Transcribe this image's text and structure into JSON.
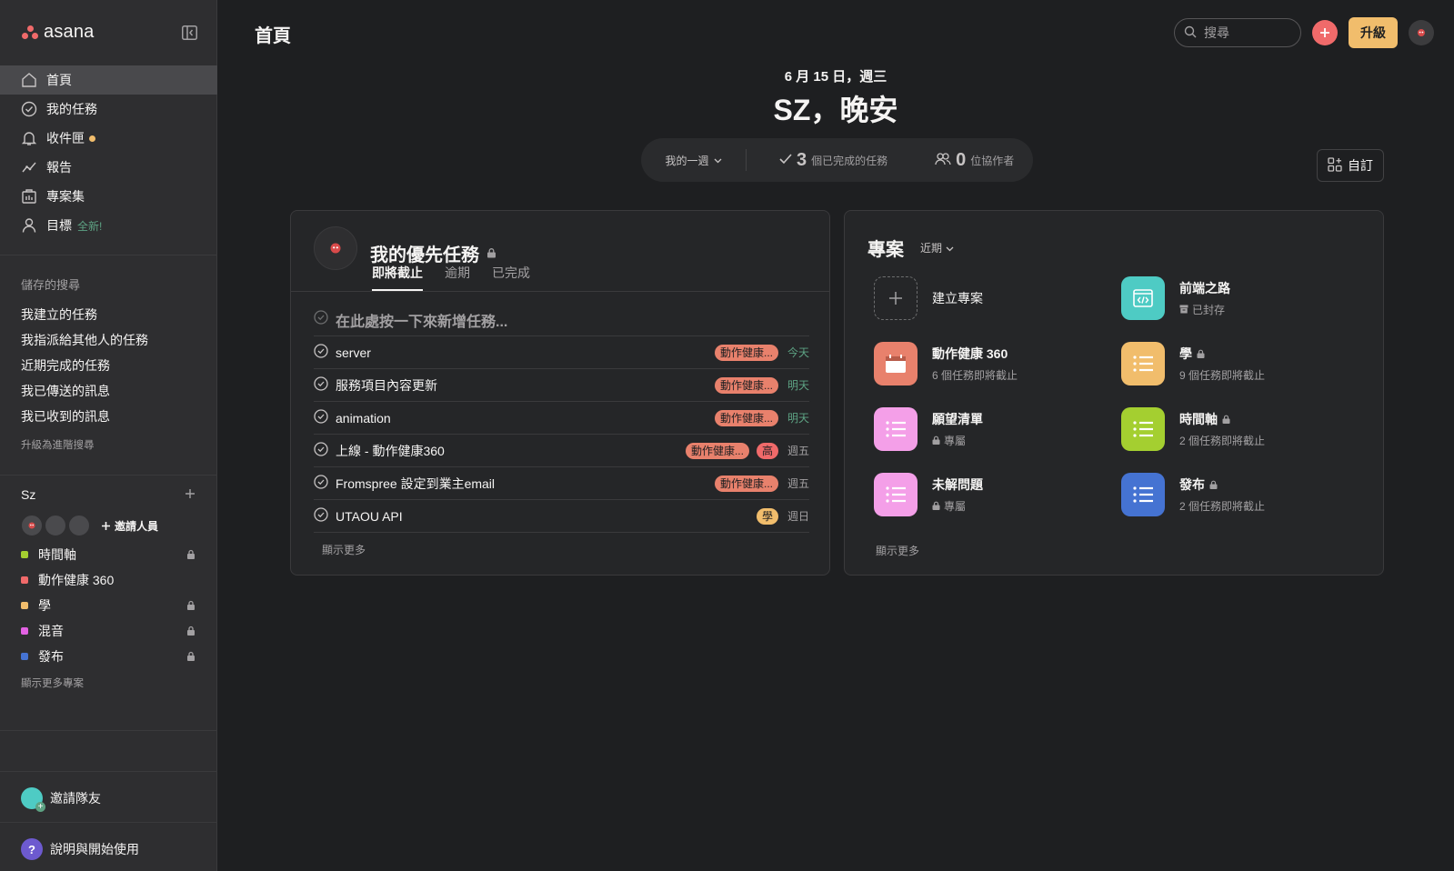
{
  "brand": {
    "name": "asana"
  },
  "colors": {
    "accent": "#f06a6a",
    "upgrade": "#f1bd6c",
    "green": "#5da283"
  },
  "nav": {
    "items": [
      {
        "label": "首頁",
        "icon": "home-icon"
      },
      {
        "label": "我的任務",
        "icon": "check-circle-icon"
      },
      {
        "label": "收件匣",
        "icon": "bell-icon"
      },
      {
        "label": "報告",
        "icon": "chart-line-icon"
      },
      {
        "label": "專案集",
        "icon": "portfolio-icon"
      },
      {
        "label": "目標",
        "icon": "goal-icon",
        "tag": "全新!"
      }
    ]
  },
  "saved_searches": {
    "title": "儲存的搜尋",
    "items": [
      "我建立的任務",
      "我指派給其他人的任務",
      "近期完成的任務",
      "我已傳送的訊息",
      "我已收到的訊息"
    ],
    "upgrade_link": "升級為進階搜尋"
  },
  "team": {
    "name": "Sz",
    "invite_label": "邀請人員",
    "projects": [
      {
        "name": "時間軸",
        "color": "#a4cf30",
        "locked": true
      },
      {
        "name": "動作健康 360",
        "color": "#f06a6a",
        "locked": false
      },
      {
        "name": "學",
        "color": "#f1bd6c",
        "locked": true
      },
      {
        "name": "混音",
        "color": "#e362e3",
        "locked": true
      },
      {
        "name": "發布",
        "color": "#4573d2",
        "locked": true
      }
    ],
    "show_more": "顯示更多專案"
  },
  "bottom": {
    "invite_teammates": "邀請隊友",
    "help": "說明與開始使用",
    "help_glyph": "?"
  },
  "header": {
    "title": "首頁",
    "search_placeholder": "搜尋",
    "upgrade_label": "升級"
  },
  "greeting": {
    "date": "6 月 15 日，週三",
    "text": "SZ，晚安"
  },
  "stats": {
    "period": "我的一週",
    "completed_count": "3",
    "completed_label": "個已完成的任務",
    "collaborators_count": "0",
    "collaborators_label": "位協作者"
  },
  "customize_label": "自訂",
  "priorities": {
    "title": "我的優先任務",
    "tabs": [
      "即將截止",
      "逾期",
      "已完成"
    ],
    "add_placeholder": "在此處按一下來新增任務...",
    "tasks": [
      {
        "name": "server",
        "tags": [
          {
            "text": "動作健康...",
            "kind": "project"
          }
        ],
        "due": "今天",
        "due_green": true
      },
      {
        "name": "服務項目內容更新",
        "tags": [
          {
            "text": "動作健康...",
            "kind": "project"
          }
        ],
        "due": "明天",
        "due_green": true
      },
      {
        "name": "animation",
        "tags": [
          {
            "text": "動作健康...",
            "kind": "project"
          }
        ],
        "due": "明天",
        "due_green": true
      },
      {
        "name": "上線 - 動作健康360",
        "tags": [
          {
            "text": "動作健康...",
            "kind": "project"
          },
          {
            "text": "高",
            "kind": "high"
          }
        ],
        "due": "週五",
        "due_green": false
      },
      {
        "name": "Fromspree 設定到業主email",
        "tags": [
          {
            "text": "動作健康...",
            "kind": "project"
          }
        ],
        "due": "週五",
        "due_green": false
      },
      {
        "name": "UTAOU API",
        "tags": [
          {
            "text": "學",
            "kind": "study"
          }
        ],
        "due": "週日",
        "due_green": false
      }
    ],
    "show_more": "顯示更多"
  },
  "projects": {
    "title": "專案",
    "sort": "近期",
    "create_label": "建立專案",
    "items": [
      {
        "name": "前端之路",
        "sub": "已封存",
        "sub_icon": "archive-icon",
        "color": "#4ecbc4",
        "icon": "code-icon",
        "locked": false
      },
      {
        "name": "動作健康 360",
        "sub": "6 個任務即將截止",
        "color": "#e8816c",
        "icon": "calendar-icon",
        "locked": false
      },
      {
        "name": "學",
        "sub": "9 個任務即將截止",
        "color": "#f1bd6c",
        "icon": "list-icon",
        "locked": true
      },
      {
        "name": "願望清單",
        "sub": "專屬",
        "sub_icon": "lock-icon",
        "color": "#f49fe8",
        "icon": "list-icon",
        "locked": false
      },
      {
        "name": "時間軸",
        "sub": "2 個任務即將截止",
        "color": "#a4cf30",
        "icon": "list-icon",
        "locked": true
      },
      {
        "name": "未解問題",
        "sub": "專屬",
        "sub_icon": "lock-icon",
        "color": "#f49fe8",
        "icon": "list-icon",
        "locked": false
      },
      {
        "name": "發布",
        "sub": "2 個任務即將截止",
        "color": "#4573d2",
        "icon": "list-icon",
        "locked": true
      }
    ],
    "show_more": "顯示更多"
  }
}
